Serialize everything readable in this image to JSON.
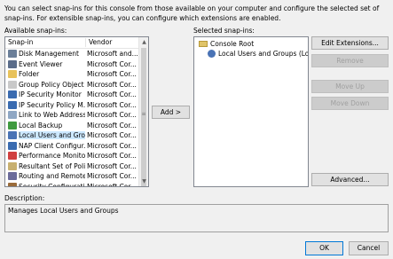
{
  "intro_text": "You can select snap-ins for this console from those available on your computer and configure the selected set of snap-ins. For extensible snap-ins, you can configure which extensions are enabled.",
  "available": {
    "label": "Available snap-ins:",
    "col_snapin": "Snap-in",
    "col_vendor": "Vendor",
    "rows": [
      {
        "name": "Disk Management",
        "vendor": "Microsoft and...",
        "icon": "disk-icon",
        "color": "#6b7f99"
      },
      {
        "name": "Event Viewer",
        "vendor": "Microsoft Cor...",
        "icon": "event-viewer-icon",
        "color": "#5a6c8a"
      },
      {
        "name": "Folder",
        "vendor": "Microsoft Cor...",
        "icon": "folder-icon",
        "color": "#e8c25a"
      },
      {
        "name": "Group Policy Object ...",
        "vendor": "Microsoft Cor...",
        "icon": "policy-icon",
        "color": "#c9c9c9"
      },
      {
        "name": "IP Security Monitor",
        "vendor": "Microsoft Cor...",
        "icon": "security-icon",
        "color": "#3a6bb0"
      },
      {
        "name": "IP Security Policy M...",
        "vendor": "Microsoft Cor...",
        "icon": "security-policy-icon",
        "color": "#3a6bb0"
      },
      {
        "name": "Link to Web Address",
        "vendor": "Microsoft Cor...",
        "icon": "link-icon",
        "color": "#8fa7c4"
      },
      {
        "name": "Local Backup",
        "vendor": "Microsoft Cor...",
        "icon": "backup-icon",
        "color": "#3f9a3f"
      },
      {
        "name": "Local Users and Gro...",
        "vendor": "Microsoft Cor...",
        "icon": "users-icon",
        "color": "#4a73b5",
        "selected": true
      },
      {
        "name": "NAP Client Configur...",
        "vendor": "Microsoft Cor...",
        "icon": "nap-icon",
        "color": "#3a6bb0"
      },
      {
        "name": "Performance Monitor",
        "vendor": "Microsoft Cor...",
        "icon": "performance-icon",
        "color": "#d04040"
      },
      {
        "name": "Resultant Set of Policy",
        "vendor": "Microsoft Cor...",
        "icon": "rsop-icon",
        "color": "#c8b070"
      },
      {
        "name": "Routing and Remote...",
        "vendor": "Microsoft Cor...",
        "icon": "routing-icon",
        "color": "#6b6b9a"
      },
      {
        "name": "Security Configurati...",
        "vendor": "Microsoft Cor...",
        "icon": "security-config-icon",
        "color": "#9a6b3a"
      }
    ]
  },
  "add_button": "Add >",
  "selected": {
    "label": "Selected snap-ins:",
    "root": "Console Root",
    "child": "Local Users and Groups (Local)"
  },
  "buttons": {
    "edit_extensions": "Edit Extensions...",
    "remove": "Remove",
    "move_up": "Move Up",
    "move_down": "Move Down",
    "advanced": "Advanced...",
    "ok": "OK",
    "cancel": "Cancel"
  },
  "description": {
    "label": "Description:",
    "text": "Manages Local Users and Groups"
  }
}
